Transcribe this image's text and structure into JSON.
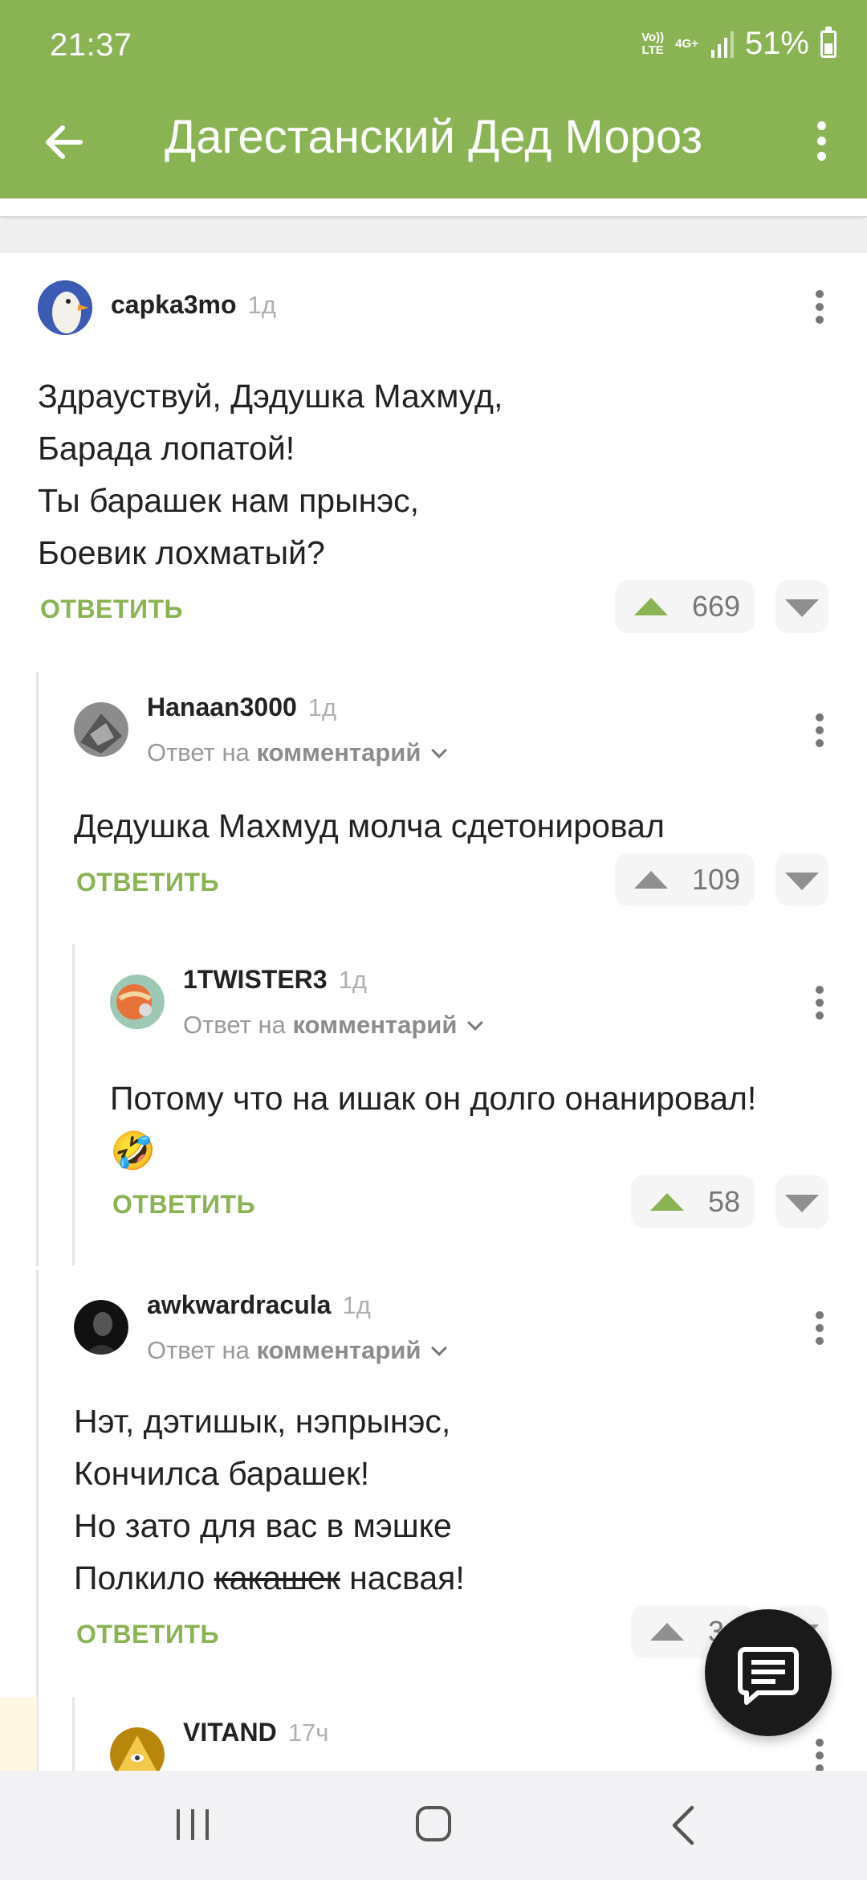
{
  "status_bar": {
    "time": "21:37",
    "volte": "Vo))\nLTE",
    "network": "4G+",
    "battery": "51%"
  },
  "toolbar": {
    "title": "Дагестанский Дед Мороз"
  },
  "reply_label": "ОТВЕТИТЬ",
  "reply_to_prefix": "Ответ на",
  "reply_to_target": "комментарий",
  "comments": [
    {
      "user": "capka3mo",
      "age": "1д",
      "lines": [
        "Здрауствуй, Дэдушка Махмуд,",
        "Барада лопатой!",
        "Ты барашек нам прынэс,",
        "Боевик лохматый?"
      ],
      "votes": "669"
    },
    {
      "user": "Hanaan3000",
      "age": "1д",
      "lines": [
        "Дедушка Махмуд молча сдетонировал"
      ],
      "votes": "109"
    },
    {
      "user": "1TWISTER3",
      "age": "1д",
      "lines": [
        "Потому что на ишак он долго онанировал!",
        "🤣"
      ],
      "votes": "58"
    },
    {
      "user": "awkwardracula",
      "age": "1д",
      "lines": [
        "Нэт, дэтишык, нэпрынэс,",
        "Кончилса барашек!",
        "Но зато для вас в мэшке"
      ],
      "line4_before": "Полкило",
      "line4_strike": "какашек",
      "line4_after": "насвая!",
      "votes": "3"
    },
    {
      "user": "VITAND",
      "age": "17ч"
    }
  ],
  "icons": {
    "back": "arrow-left-icon",
    "menu": "more-vertical-icon",
    "fab": "comment-icon",
    "nav": [
      "recent-apps-icon",
      "home-icon",
      "back-icon"
    ]
  },
  "colors": {
    "accent": "#8ab354",
    "fab": "#1a1a1a"
  }
}
